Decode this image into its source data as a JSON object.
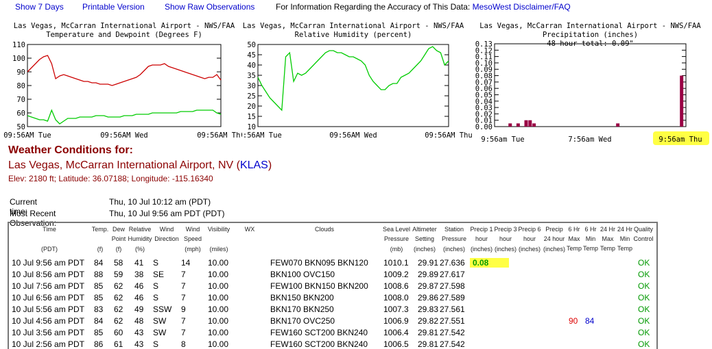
{
  "toplinks": {
    "show7": "Show 7 Days",
    "printable": "Printable Version",
    "raw": "Show Raw Observations",
    "info": "For Information Regarding the Accuracy of This Data:",
    "disclaimer": "MesoWest Disclaimer/FAQ"
  },
  "charts": [
    {
      "title1": "Las Vegas, McCarran International Airport - NWS/FAA",
      "title2": "Temperature and Dewpoint (Degrees F)",
      "yticks": [
        "110",
        "100",
        "90",
        "80",
        "70",
        "60",
        "50"
      ],
      "xticks": [
        "09:56AM Tue",
        "09:56AM Wed",
        "09:56AM Thu"
      ],
      "colors": {
        "temp": "#cc0000",
        "dew": "#00cc00"
      }
    },
    {
      "title1": "Las Vegas, McCarran International Airport - NWS/FAA",
      "title2": "Relative Humidity (percent)",
      "yticks": [
        "50",
        "45",
        "40",
        "35",
        "30",
        "25",
        "20",
        "15",
        "10"
      ],
      "xticks": [
        "09:56AM Tue",
        "09:56AM Wed",
        "09:56AM Thu"
      ],
      "colors": {
        "rh": "#00cc00"
      }
    },
    {
      "title1": "Las Vegas, McCarran International Airport - NWS/FAA",
      "title2": "Precipitation (inches)",
      "title3": "48-hour total: 0.09\"",
      "yticks": [
        "0.13",
        "0.12",
        "0.11",
        "0.10",
        "0.09",
        "0.08",
        "0.07",
        "0.06",
        "0.05",
        "0.04",
        "0.03",
        "0.02",
        "0.01",
        "0.00"
      ],
      "xticks": [
        "9:56am Tue",
        "7:56am Wed",
        "9:56am Thu"
      ],
      "colors": {
        "bar": "#990044",
        "highlight": "#ffff44"
      }
    }
  ],
  "chart_data": [
    {
      "type": "line",
      "title": "Temperature and Dewpoint (Degrees F)",
      "ylim": [
        50,
        110
      ],
      "x_hours": [
        0,
        1,
        2,
        3,
        4,
        5,
        6,
        7,
        8,
        9,
        10,
        11,
        12,
        13,
        14,
        15,
        16,
        17,
        18,
        19,
        20,
        21,
        22,
        23,
        24,
        25,
        26,
        27,
        28,
        29,
        30,
        31,
        32,
        33,
        34,
        35,
        36,
        37,
        38,
        39,
        40,
        41,
        42,
        43,
        44,
        45,
        46,
        47,
        48
      ],
      "series": [
        {
          "name": "Temperature",
          "values": [
            90,
            93,
            96,
            99,
            101,
            102,
            96,
            85,
            87,
            88,
            87,
            86,
            85,
            84,
            83,
            83,
            82,
            82,
            81,
            81,
            81,
            80,
            81,
            82,
            83,
            84,
            85,
            86,
            88,
            91,
            94,
            95,
            95,
            95,
            96,
            94,
            93,
            92,
            91,
            90,
            89,
            88,
            87,
            86,
            85,
            86,
            86,
            88,
            84
          ]
        },
        {
          "name": "Dewpoint",
          "values": [
            58,
            57,
            56,
            55,
            55,
            54,
            62,
            55,
            52,
            54,
            56,
            56,
            56,
            57,
            57,
            57,
            57,
            58,
            58,
            58,
            57,
            57,
            57,
            57,
            58,
            58,
            58,
            59,
            59,
            59,
            59,
            60,
            60,
            60,
            60,
            60,
            60,
            60,
            61,
            61,
            61,
            61,
            62,
            62,
            62,
            62,
            62,
            60,
            59
          ]
        }
      ]
    },
    {
      "type": "line",
      "title": "Relative Humidity (percent)",
      "ylim": [
        10,
        50
      ],
      "x_hours": [
        0,
        1,
        2,
        3,
        4,
        5,
        6,
        7,
        8,
        9,
        10,
        11,
        12,
        13,
        14,
        15,
        16,
        17,
        18,
        19,
        20,
        21,
        22,
        23,
        24,
        25,
        26,
        27,
        28,
        29,
        30,
        31,
        32,
        33,
        34,
        35,
        36,
        37,
        38,
        39,
        40,
        41,
        42,
        43,
        44,
        45,
        46,
        47,
        48
      ],
      "series": [
        {
          "name": "Relative Humidity",
          "values": [
            34,
            30,
            27,
            24,
            22,
            20,
            18,
            44,
            46,
            32,
            36,
            35,
            36,
            38,
            40,
            42,
            44,
            46,
            47,
            47,
            46,
            46,
            45,
            44,
            44,
            43,
            42,
            40,
            35,
            32,
            30,
            28,
            28,
            30,
            31,
            31,
            34,
            35,
            36,
            38,
            40,
            42,
            45,
            48,
            49,
            47,
            46,
            40,
            42
          ]
        }
      ]
    },
    {
      "type": "bar",
      "title": "Precipitation (inches)",
      "ylim": [
        0,
        0.13
      ],
      "x_hours": [
        4,
        6,
        8,
        9,
        10,
        31,
        47
      ],
      "values": [
        0.005,
        0.005,
        0.01,
        0.01,
        0.005,
        0.005,
        0.08
      ]
    }
  ],
  "conditions": {
    "title": "Weather Conditions for:",
    "station_name": "Las Vegas, McCarran International Airport, NV (",
    "icao": "KLAS",
    "station_close": ")",
    "elev": "Elev: 2180 ft; Latitude: 36.07188; Longitude: -115.16340",
    "current_label": "Current time:",
    "current_value": "Thu, 10 Jul 10:12 am (PDT)",
    "recent_label": "Most Recent Observation:",
    "recent_value": "Thu, 10 Jul 9:56 am PDT (PDT)"
  },
  "table": {
    "headers": {
      "time": "Time",
      "temp": "Temp.",
      "dew": "Dew Point",
      "rh": "Relative Humidity",
      "wind": "Wind Direction",
      "speed": "Wind Speed",
      "vis": "Visibility",
      "wx": "WX",
      "clouds": "Clouds",
      "slp": "Sea Level Pressure",
      "alt": "Altimeter Setting",
      "stn": "Station Pressure",
      "p1": "Precip 1 hour",
      "p3": "Precip 3 hour",
      "p6": "Precip 6 hour",
      "p24": "Precip 24 hour",
      "mx6": "6 Hr Max Temp",
      "mn6": "6 Hr Min Temp",
      "mx24": "24 Hr Max Temp",
      "mn24": "24 Hr Min Temp",
      "qc": "Quality Control"
    },
    "units": {
      "time": "(PDT)",
      "temp": "(f)",
      "dew": "(f)",
      "rh": "(%)",
      "speed": "(mph)",
      "vis": "(miles)",
      "slp": "(mb)",
      "alt": "(inches)",
      "stn": "(inches)",
      "p1": "(inches)",
      "p3": "(inches)",
      "p6": "(inches)",
      "p24": "(inches)"
    },
    "rows": [
      {
        "time": "10 Jul 9:56 am PDT",
        "temp": "84",
        "dew": "58",
        "rh": "41",
        "dir": "S",
        "spd": "14",
        "vis": "10.00",
        "clouds": "FEW070 BKN095 BKN120",
        "slp": "1010.1",
        "alt": "29.91",
        "stn": "27.636",
        "p1": "0.08",
        "mx6": "",
        "mn6": "",
        "qc": "OK"
      },
      {
        "time": "10 Jul 8:56 am PDT",
        "temp": "88",
        "dew": "59",
        "rh": "38",
        "dir": "SE",
        "spd": "7",
        "vis": "10.00",
        "clouds": "BKN100 OVC150",
        "slp": "1009.2",
        "alt": "29.89",
        "stn": "27.617",
        "p1": "",
        "mx6": "",
        "mn6": "",
        "qc": "OK"
      },
      {
        "time": "10 Jul 7:56 am PDT",
        "temp": "85",
        "dew": "62",
        "rh": "46",
        "dir": "S",
        "spd": "7",
        "vis": "10.00",
        "clouds": "FEW100 BKN150 BKN200",
        "slp": "1008.6",
        "alt": "29.87",
        "stn": "27.598",
        "p1": "",
        "mx6": "",
        "mn6": "",
        "qc": "OK"
      },
      {
        "time": "10 Jul 6:56 am PDT",
        "temp": "85",
        "dew": "62",
        "rh": "46",
        "dir": "S",
        "spd": "7",
        "vis": "10.00",
        "clouds": "BKN150 BKN200",
        "slp": "1008.0",
        "alt": "29.86",
        "stn": "27.589",
        "p1": "",
        "mx6": "",
        "mn6": "",
        "qc": "OK"
      },
      {
        "time": "10 Jul 5:56 am PDT",
        "temp": "83",
        "dew": "62",
        "rh": "49",
        "dir": "SSW",
        "spd": "9",
        "vis": "10.00",
        "clouds": "BKN170 BKN250",
        "slp": "1007.3",
        "alt": "29.83",
        "stn": "27.561",
        "p1": "",
        "mx6": "",
        "mn6": "",
        "qc": "OK"
      },
      {
        "time": "10 Jul 4:56 am PDT",
        "temp": "84",
        "dew": "62",
        "rh": "48",
        "dir": "SW",
        "spd": "7",
        "vis": "10.00",
        "clouds": "BKN170 OVC250",
        "slp": "1006.9",
        "alt": "29.82",
        "stn": "27.551",
        "p1": "",
        "mx6": "90",
        "mn6": "84",
        "qc": "OK"
      },
      {
        "time": "10 Jul 3:56 am PDT",
        "temp": "85",
        "dew": "60",
        "rh": "43",
        "dir": "SW",
        "spd": "7",
        "vis": "10.00",
        "clouds": "FEW160 SCT200 BKN240",
        "slp": "1006.4",
        "alt": "29.81",
        "stn": "27.542",
        "p1": "",
        "mx6": "",
        "mn6": "",
        "qc": "OK"
      },
      {
        "time": "10 Jul 2:56 am PDT",
        "temp": "86",
        "dew": "61",
        "rh": "43",
        "dir": "S",
        "spd": "8",
        "vis": "10.00",
        "clouds": "FEW160 SCT200 BKN240",
        "slp": "1006.5",
        "alt": "29.81",
        "stn": "27.542",
        "p1": "",
        "mx6": "",
        "mn6": "",
        "qc": "OK"
      }
    ]
  }
}
